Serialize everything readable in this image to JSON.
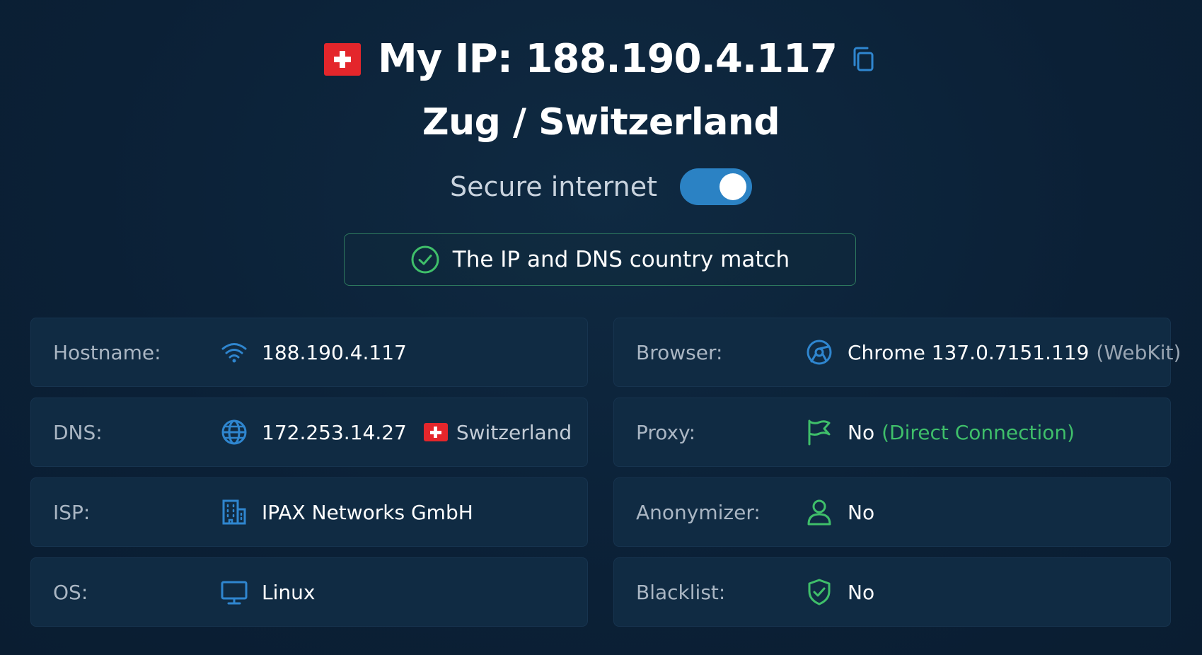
{
  "header": {
    "title": "My IP: 188.190.4.117",
    "location": "Zug / Switzerland"
  },
  "secure": {
    "label": "Secure internet",
    "enabled": true
  },
  "match": {
    "text": "The IP and DNS country match"
  },
  "left_cards": [
    {
      "label": "Hostname:",
      "icon": "wifi-icon",
      "value": "188.190.4.117"
    },
    {
      "label": "DNS:",
      "icon": "globe-icon",
      "value": "172.253.14.27",
      "country": "Switzerland"
    },
    {
      "label": "ISP:",
      "icon": "building-icon",
      "value": "IPAX Networks GmbH"
    },
    {
      "label": "OS:",
      "icon": "monitor-icon",
      "value": "Linux"
    }
  ],
  "right_cards": [
    {
      "label": "Browser:",
      "icon": "browser-icon",
      "value": "Chrome 137.0.7151.119",
      "extra": "(WebKit)"
    },
    {
      "label": "Proxy:",
      "icon": "flag-icon",
      "value": "No",
      "extra": "(Direct Connection)"
    },
    {
      "label": "Anonymizer:",
      "icon": "user-icon",
      "value": "No"
    },
    {
      "label": "Blacklist:",
      "icon": "shield-check-icon",
      "value": "No"
    }
  ],
  "colors": {
    "background": "#0c2238",
    "card": "#102b43",
    "accent_blue": "#2b82c4",
    "accent_green": "#3fbf6a",
    "flag_red": "#e4262b"
  }
}
